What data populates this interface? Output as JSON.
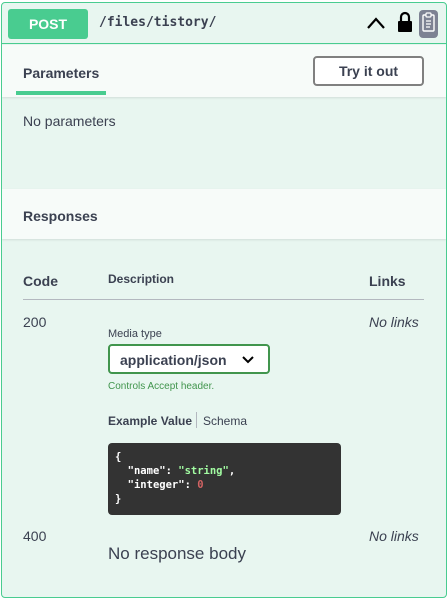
{
  "operation": {
    "method": "POST",
    "path": "/files/tistory/",
    "icons": [
      "chevron-up-icon",
      "lock-icon",
      "copy-icon"
    ]
  },
  "parameters": {
    "tab_label": "Parameters",
    "try_button": "Try it out",
    "empty_text": "No parameters"
  },
  "responses": {
    "title": "Responses",
    "columns": {
      "code": "Code",
      "description": "Description",
      "links": "Links"
    },
    "rows": [
      {
        "code": "200",
        "links": "No links",
        "media_type_label": "Media type",
        "media_type_value": "application/json",
        "accept_note": "Controls Accept header.",
        "example_tab": "Example Value",
        "schema_tab": "Schema",
        "example": {
          "open": "{",
          "key1": "\"name\"",
          "val1": "\"string\"",
          "key2": "\"integer\"",
          "val2": "0",
          "close": "}"
        }
      },
      {
        "code": "400",
        "links": "No links",
        "body_text": "No response body"
      }
    ]
  },
  "colors": {
    "post_green": "#49cc90",
    "background": "#e8f6f0",
    "text": "#3b4151",
    "select_border": "#41954d",
    "code_bg": "#333333"
  }
}
